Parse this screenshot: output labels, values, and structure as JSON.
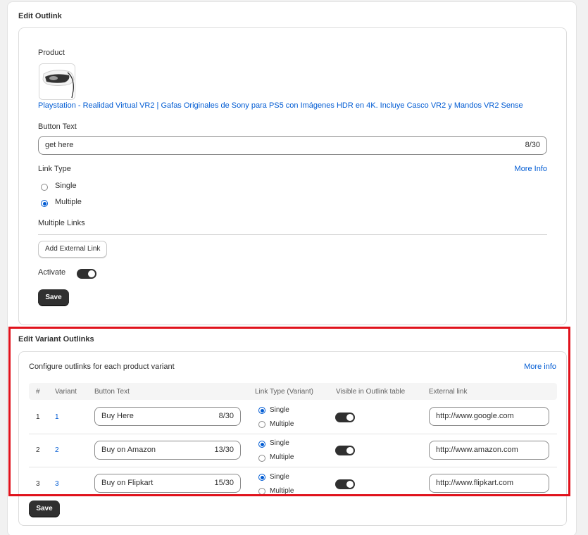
{
  "outlink": {
    "title": "Edit Outlink",
    "product_label": "Product",
    "product_image_icon": "vr-headset-image",
    "product_name": "Playstation - Realidad Virtual VR2 | Gafas Originales de Sony para PS5 con Imágenes HDR en 4K. Incluye Casco VR2 y Mandos VR2 Sense",
    "button_text_label": "Button Text",
    "button_text_value": "get here",
    "button_text_count": "8/30",
    "link_type_label": "Link Type",
    "more_info": "More Info",
    "link_type_options": [
      "Single",
      "Multiple"
    ],
    "link_type_selected": "Multiple",
    "multiple_links_label": "Multiple Links",
    "add_external_link": "Add External Link",
    "activate_label": "Activate",
    "activate_on": true,
    "save": "Save"
  },
  "variants": {
    "title": "Edit Variant Outlinks",
    "description": "Configure outlinks for each product variant",
    "more_info": "More info",
    "columns": [
      "#",
      "Variant",
      "Button Text",
      "Link Type (Variant)",
      "Visible in Outlink table",
      "External link"
    ],
    "rows": [
      {
        "index": "1",
        "variant": "1",
        "button_text": "Buy Here",
        "count": "8/30",
        "link_type": "Single",
        "option_single": "Single",
        "option_multiple": "Multiple",
        "visible": true,
        "external_link": "http://www.google.com"
      },
      {
        "index": "2",
        "variant": "2",
        "button_text": "Buy on Amazon",
        "count": "13/30",
        "link_type": "Single",
        "option_single": "Single",
        "option_multiple": "Multiple",
        "visible": true,
        "external_link": "http://www.amazon.com"
      },
      {
        "index": "3",
        "variant": "3",
        "button_text": "Buy on Flipkart",
        "count": "15/30",
        "link_type": "Single",
        "option_single": "Single",
        "option_multiple": "Multiple",
        "visible": true,
        "external_link": "http://www.flipkart.com"
      }
    ],
    "save": "Save"
  },
  "colors": {
    "accent": "#005bd3",
    "dark_button": "#303030",
    "highlight": "#e0121c"
  }
}
